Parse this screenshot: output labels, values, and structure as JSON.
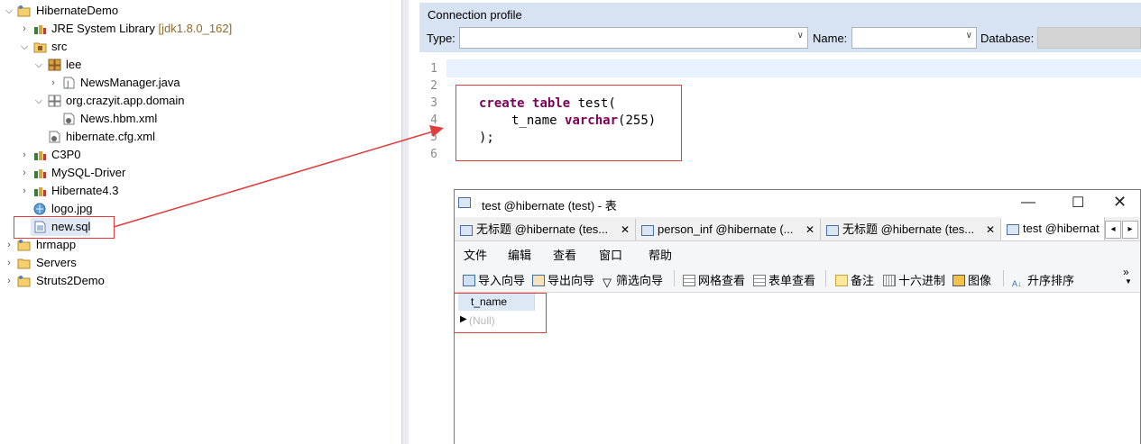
{
  "explorer": {
    "items": [
      {
        "label": "HibernateDemo",
        "suffix": ""
      },
      {
        "label": "JRE System Library",
        "suffix": "[jdk1.8.0_162]"
      },
      {
        "label": "src",
        "suffix": ""
      },
      {
        "label": "lee",
        "suffix": ""
      },
      {
        "label": "NewsManager.java",
        "suffix": ""
      },
      {
        "label": "org.crazyit.app.domain",
        "suffix": ""
      },
      {
        "label": "News.hbm.xml",
        "suffix": ""
      },
      {
        "label": "hibernate.cfg.xml",
        "suffix": ""
      },
      {
        "label": "C3P0",
        "suffix": ""
      },
      {
        "label": "MySQL-Driver",
        "suffix": ""
      },
      {
        "label": "Hibernate4.3",
        "suffix": ""
      },
      {
        "label": "logo.jpg",
        "suffix": ""
      },
      {
        "label": "new.sql",
        "suffix": ""
      },
      {
        "label": "hrmapp",
        "suffix": ""
      },
      {
        "label": "Servers",
        "suffix": ""
      },
      {
        "label": "Struts2Demo",
        "suffix": ""
      }
    ]
  },
  "connection_profile": {
    "title": "Connection profile",
    "type_label": "Type:",
    "name_label": "Name:",
    "database_label": "Database:",
    "type_value": "",
    "name_value": "",
    "database_value": ""
  },
  "editor": {
    "line_numbers": [
      "1",
      "2",
      "3",
      "4",
      "5",
      "6"
    ],
    "code": {
      "l1_kw1": "create",
      "l1_kw2": "table",
      "l1_rest": " test(",
      "l2_name": "t_name ",
      "l2_kw": "varchar",
      "l2_rest": "(255)",
      "l3": ");"
    }
  },
  "navicat": {
    "title": "test @hibernate (test) - 表",
    "tabs": [
      {
        "label": "无标题 @hibernate (tes..."
      },
      {
        "label": "person_inf @hibernate (..."
      },
      {
        "label": "无标题 @hibernate (tes..."
      },
      {
        "label": "test @hibernat"
      }
    ],
    "menu": [
      "文件",
      "编辑",
      "查看",
      "窗口",
      "帮助"
    ],
    "toolbar": [
      "导入向导",
      "导出向导",
      "筛选向导",
      "网格查看",
      "表单查看",
      "备注",
      "十六进制",
      "图像",
      "升序排序"
    ],
    "grid": {
      "columns": [
        "t_name"
      ],
      "rows": [
        [
          "(Null)"
        ]
      ]
    }
  },
  "colors": {
    "annotation": "#e23b3b",
    "keyword": "#7f0055",
    "connection_bg": "#d7e2f2"
  }
}
